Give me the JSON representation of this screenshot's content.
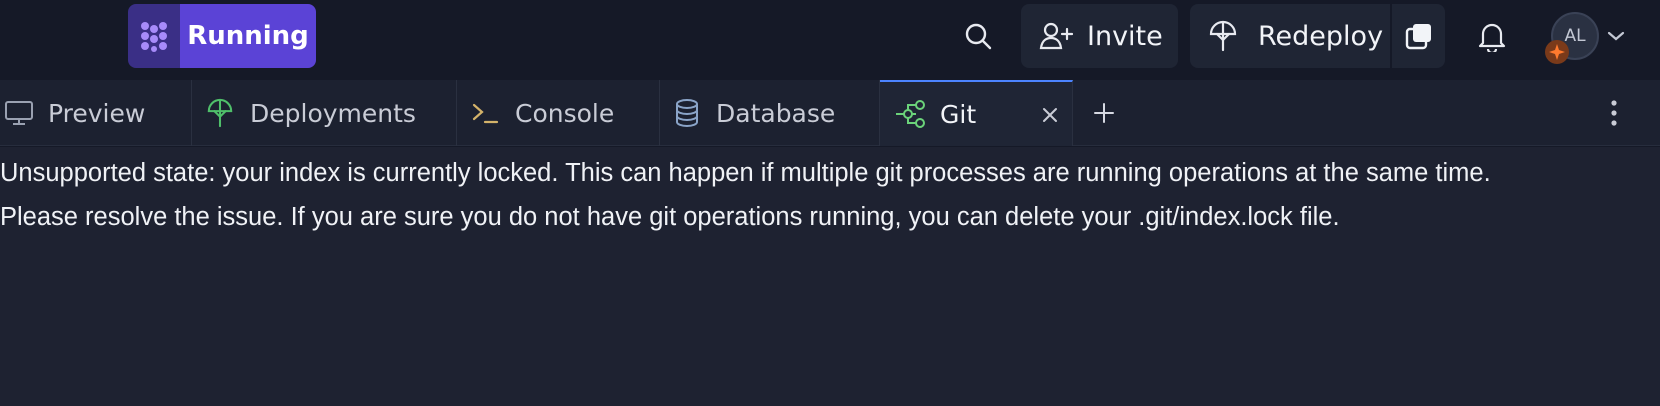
{
  "header": {
    "run_status_label": "Running",
    "invite_label": "Invite",
    "redeploy_label": "Redeploy",
    "avatar_initials": "AL"
  },
  "tabs": [
    {
      "label": "Preview",
      "icon": "monitor-icon",
      "active": false
    },
    {
      "label": "Deployments",
      "icon": "deploy-icon",
      "active": false
    },
    {
      "label": "Console",
      "icon": "terminal-icon",
      "active": false
    },
    {
      "label": "Database",
      "icon": "database-icon",
      "active": false
    },
    {
      "label": "Git",
      "icon": "git-branch-icon",
      "active": true
    }
  ],
  "git_panel": {
    "message_line1": "Unsupported state: your index is currently locked. This can happen if multiple git processes are running operations at the same time.",
    "message_line2": "Please resolve the issue. If you are sure you do not have git operations running, you can delete your .git/index.lock file."
  },
  "colors": {
    "background": "#151927",
    "run_accent": "#5b43d6",
    "active_tab_border": "#4c84ff",
    "deploy_icon": "#4fbf6a",
    "git_icon": "#6bd37a"
  }
}
